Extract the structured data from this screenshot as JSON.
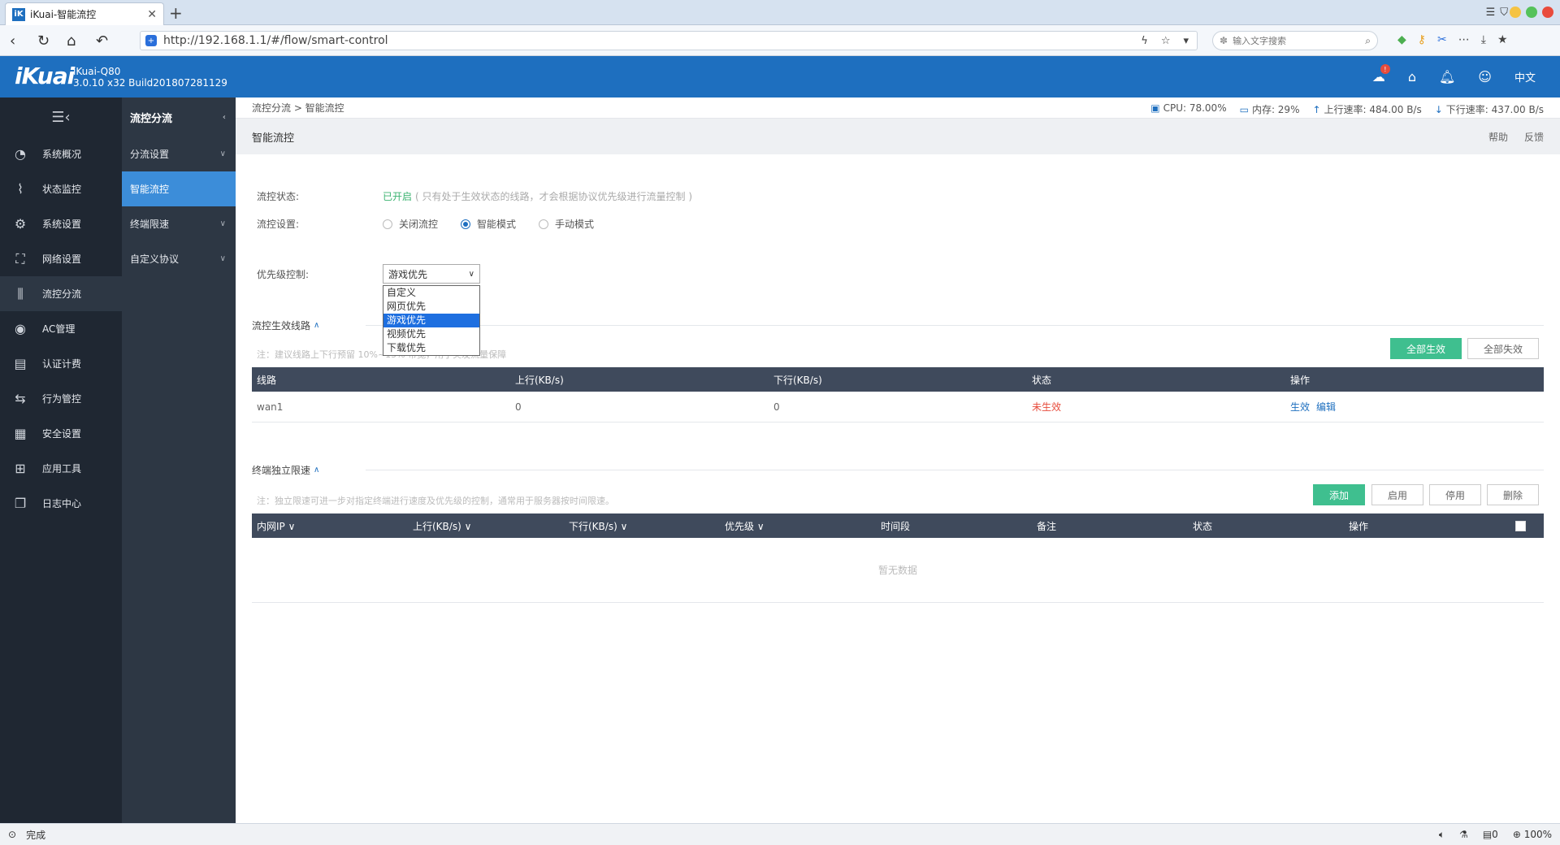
{
  "browser": {
    "tab_title": "iKuai-智能流控",
    "favicon": "iK",
    "url": "http://192.168.1.1/#/flow/smart-control",
    "search_placeholder": "输入文字搜索",
    "status_text": "完成",
    "zoom": "100%",
    "status_count": "0"
  },
  "header": {
    "logo": "iKuai",
    "model": "iKuai-Q80",
    "build": "3.0.10 x32 Build201807281129",
    "badge": "!",
    "lang": "中文"
  },
  "sidebar": {
    "items": [
      {
        "label": "系统概况",
        "icon": "dashboard-icon"
      },
      {
        "label": "状态监控",
        "icon": "monitor-icon"
      },
      {
        "label": "系统设置",
        "icon": "gear-icon"
      },
      {
        "label": "网络设置",
        "icon": "network-icon"
      },
      {
        "label": "流控分流",
        "icon": "sliders-icon"
      },
      {
        "label": "AC管理",
        "icon": "wifi-icon"
      },
      {
        "label": "认证计费",
        "icon": "id-card-icon"
      },
      {
        "label": "行为管控",
        "icon": "arrows-icon"
      },
      {
        "label": "安全设置",
        "icon": "firewall-icon"
      },
      {
        "label": "应用工具",
        "icon": "apps-icon"
      },
      {
        "label": "日志中心",
        "icon": "log-icon"
      }
    ]
  },
  "subnav": {
    "title": "流控分流",
    "items": [
      "分流设置",
      "智能流控",
      "终端限速",
      "自定义协议"
    ]
  },
  "topbar": {
    "breadcrumb": "流控分流 > 智能流控",
    "cpu": "CPU: 78.00%",
    "mem": "内存: 29%",
    "up": "上行速率: 484.00 B/s",
    "down": "下行速率: 437.00 B/s"
  },
  "page": {
    "title": "智能流控",
    "help": "帮助",
    "feedback": "反馈"
  },
  "form": {
    "status_label": "流控状态:",
    "status_value": "已开启",
    "status_note": "( 只有处于生效状态的线路，才会根据协议优先级进行流量控制 )",
    "mode_label": "流控设置:",
    "modes": [
      "关闭流控",
      "智能模式",
      "手动模式"
    ],
    "priority_label": "优先级控制:",
    "priority_selected": "游戏优先",
    "priority_options": [
      "自定义",
      "网页优先",
      "游戏优先",
      "视频优先",
      "下载优先"
    ]
  },
  "lines": {
    "title": "流控生效线路",
    "note": "注：建议线路上下行预留 10%~15% 带宽，用于突发流量保障",
    "btn_all_on": "全部生效",
    "btn_all_off": "全部失效",
    "columns": [
      "线路",
      "上行(KB/s)",
      "下行(KB/s)",
      "状态",
      "操作"
    ],
    "rows": [
      {
        "line": "wan1",
        "up": "0",
        "down": "0",
        "status": "未生效",
        "action1": "生效",
        "action2": "编辑"
      }
    ]
  },
  "terminal": {
    "title": "终端独立限速",
    "note": "注：独立限速可进一步对指定终端进行速度及优先级的控制，通常用于服务器按时间限速。",
    "btn_add": "添加",
    "btn_enable": "启用",
    "btn_disable": "停用",
    "btn_delete": "删除",
    "columns": [
      "内网IP",
      "上行(KB/s)",
      "下行(KB/s)",
      "优先级",
      "时间段",
      "备注",
      "状态",
      "操作"
    ],
    "empty": "暂无数据"
  }
}
